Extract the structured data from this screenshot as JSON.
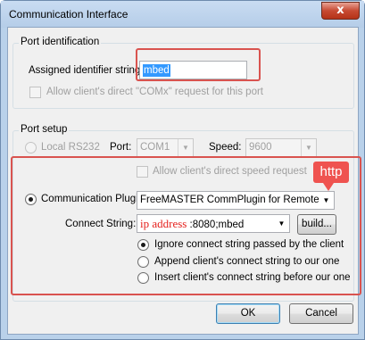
{
  "window": {
    "title": "Communication Interface",
    "close_glyph": "x"
  },
  "port_identification": {
    "legend": "Port identification",
    "identifier_label": "Assigned identifier string:",
    "identifier_value": "mbed",
    "allow_comx_label": "Allow client's direct \"COMx\" request for this port"
  },
  "port_setup": {
    "legend": "Port setup",
    "local_rs232_label": "Local RS232",
    "port_label": "Port:",
    "port_value": "COM1",
    "speed_label": "Speed:",
    "speed_value": "9600",
    "allow_speed_label": "Allow client's direct speed request",
    "comm_plugin_label": "Communication Plugin",
    "comm_plugin_value": "FreeMASTER CommPlugin for Remote Ser",
    "connect_string_label": "Connect String:",
    "connect_ip": "ip address",
    "connect_rest": " :8080;mbed",
    "build_label": "build...",
    "options": [
      {
        "label": "Ignore connect string passed by the client",
        "selected": true
      },
      {
        "label": "Append client's connect string to our one",
        "selected": false
      },
      {
        "label": "Insert client's connect string before our one",
        "selected": false
      }
    ]
  },
  "annotation": {
    "callout_text": "http",
    "highlight_color": "#d9534f"
  },
  "buttons": {
    "ok": "OK",
    "cancel": "Cancel"
  }
}
